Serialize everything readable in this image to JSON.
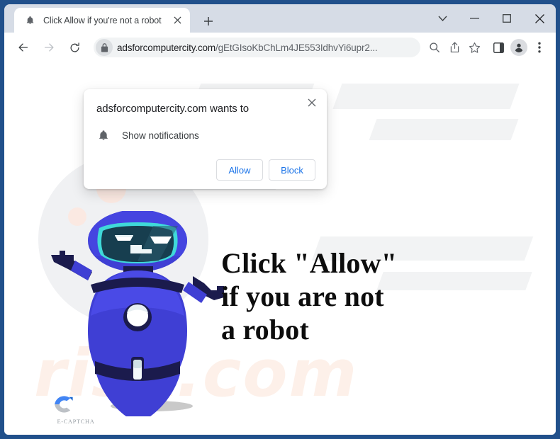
{
  "window": {
    "controls": [
      {
        "name": "tab-search-button",
        "icon": "chevron-down-icon",
        "label": ""
      },
      {
        "name": "minimize-button",
        "icon": "minimize-icon",
        "label": ""
      },
      {
        "name": "maximize-button",
        "icon": "maximize-icon",
        "label": ""
      },
      {
        "name": "close-button",
        "icon": "close-icon",
        "label": ""
      }
    ]
  },
  "tab": {
    "title": "Click Allow if you're not a robot",
    "favicon": "bell-icon",
    "close_icon": "close-icon",
    "newtab_icon": "plus-icon"
  },
  "toolbar": {
    "back_icon": "arrow-left-icon",
    "forward_icon": "arrow-right-icon",
    "reload_icon": "reload-icon",
    "lock_icon": "lock-icon",
    "url_domain": "adsforcomputercity.com",
    "url_path": "/gEtGIsoKbChLm4JE553IdhvYi6upr2...",
    "url_full": "adsforcomputercity.com/gEtGIsoKbChLm4JE553IdhvYi6upr2...",
    "icons": [
      {
        "name": "search-page-icon",
        "label": ""
      },
      {
        "name": "share-icon",
        "label": ""
      },
      {
        "name": "bookmark-star-icon",
        "label": ""
      },
      {
        "name": "side-panel-icon",
        "label": ""
      },
      {
        "name": "profile-avatar-icon",
        "label": ""
      },
      {
        "name": "more-menu-icon",
        "label": ""
      }
    ]
  },
  "notification_dialog": {
    "title": "adsforcomputercity.com wants to",
    "permission_icon": "bell-icon",
    "permission_label": "Show notifications",
    "allow_label": "Allow",
    "block_label": "Block",
    "close_icon": "close-icon"
  },
  "page": {
    "headline": "Click \"Allow\"\nif you are not\na robot",
    "watermark": "risk.com",
    "captcha_brand": "E-CAPTCHA",
    "captcha_logo_icon": "c-letter-logo-icon",
    "robot_icon": "robot-mascot-icon"
  },
  "colors": {
    "window_frame": "#21508b",
    "tabstrip": "#d6dce6",
    "accent_blue": "#1a73e8",
    "robot_body": "#3f3fd4",
    "robot_dark": "#1b1b4d",
    "robot_visor": "#173e4f",
    "robot_visor_outline": "#3fd9d9",
    "watermark": "#fdf0e9",
    "logo_blue": "#4285f4",
    "logo_gray": "#bdc1c6"
  }
}
